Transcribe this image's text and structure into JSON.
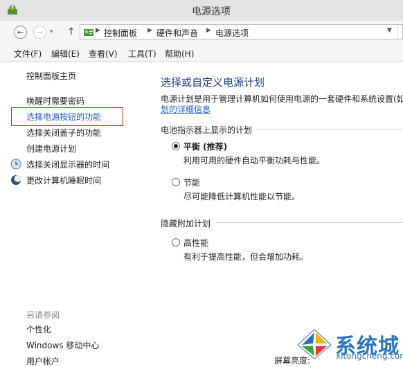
{
  "window": {
    "title": "电源选项"
  },
  "navigation": {
    "breadcrumb": [
      "控制面板",
      "硬件和声音",
      "电源选项"
    ]
  },
  "menu": [
    "文件(F)",
    "编辑(E)",
    "查看(V)",
    "工具(T)",
    "帮助(H)"
  ],
  "sidebar": {
    "home": "控制面板主页",
    "items": [
      "唤醒时需要密码",
      "选择电源按钮的功能",
      "选择关闭盖子的功能",
      "创建电源计划",
      "选择关闭显示器的时间",
      "更改计算机睡眠时间"
    ],
    "see_also_title": "另请参阅",
    "see_also": [
      "个性化",
      "Windows 移动中心",
      "用户帐户"
    ]
  },
  "main": {
    "title": "选择或自定义电源计划",
    "description": "电源计划是用于管理计算机如何使用电源的一套硬件和系统设置(如",
    "description_link": "划的详细信息",
    "battery_section": "电池指示器上显示的计划",
    "plans": [
      {
        "name": "平衡 (推荐)",
        "description": "利用可用的硬件自动平衡功耗与性能。",
        "selected": true
      },
      {
        "name": "节能",
        "description": "尽可能降低计算机性能以节能。",
        "selected": false
      }
    ],
    "hidden_section": "隐藏附加计划",
    "hidden_plans": [
      {
        "name": "高性能",
        "description": "有利于提高性能，但会增加功耗。",
        "selected": false
      }
    ]
  },
  "status_text": "屏幕亮度:",
  "watermark": {
    "name": "系统城",
    "domain": "xitongcheng.com"
  },
  "colors": {
    "link": "#1f5fc7",
    "highlight_box": "#c3291f",
    "title": "#1c3f8a",
    "watermark": "#2a76bb"
  }
}
